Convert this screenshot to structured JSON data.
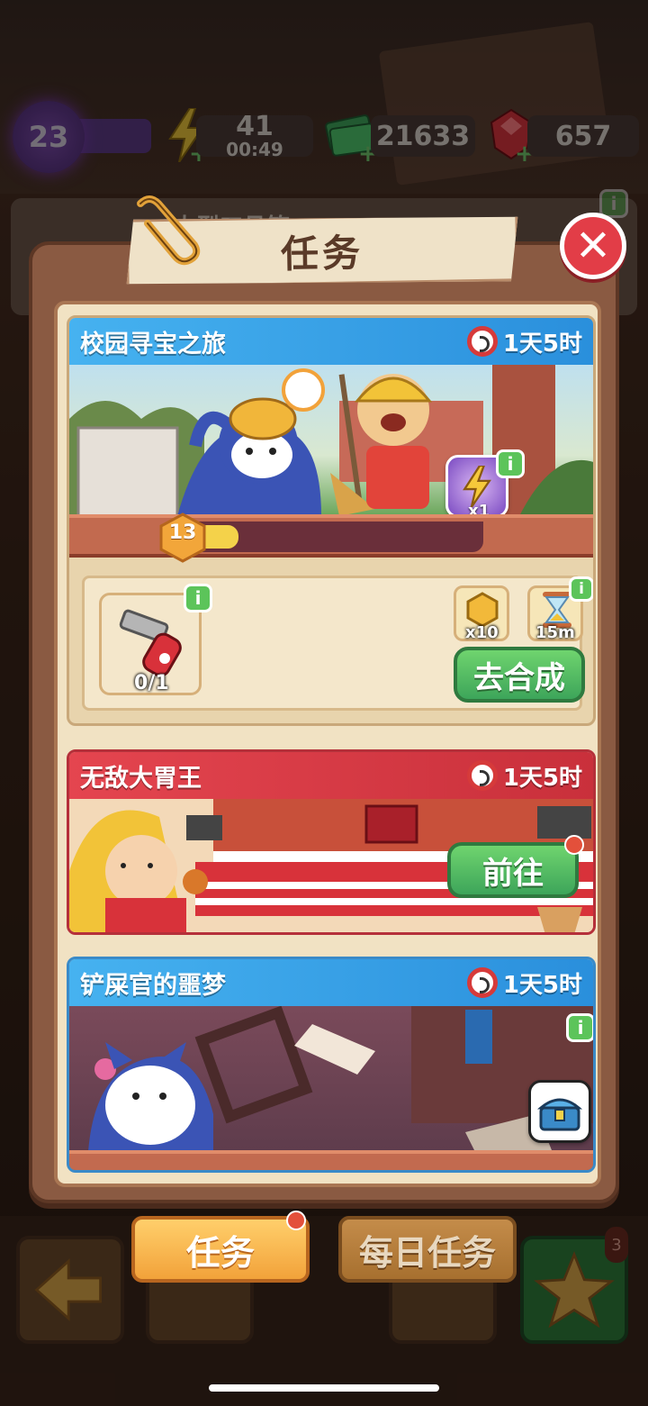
{
  "hud": {
    "level": "23",
    "energy": "41",
    "energy_timer": "00:49",
    "cash": "21633",
    "gems": "657"
  },
  "background": {
    "card_title": "大型工具箱"
  },
  "modal": {
    "title": "任务",
    "close_icon": "close-icon"
  },
  "quests": [
    {
      "title": "校园寻宝之旅",
      "timer": "1天5时",
      "header_color": "#46b2f0",
      "level_badge": "13",
      "level_progress": 0.2,
      "reward_multiplier": "x1",
      "requirement": {
        "item": "wrench-icon",
        "progress": "0/1"
      },
      "rewards": [
        {
          "icon": "coin-icon",
          "label": "x10"
        },
        {
          "icon": "hourglass-icon",
          "label": "15m"
        }
      ],
      "action_label": "去合成"
    },
    {
      "title": "无敌大胃王",
      "timer": "1天5时",
      "header_color": "#e4454f",
      "action_label": "前往"
    },
    {
      "title": "铲屎官的噩梦",
      "timer": "1天5时",
      "header_color": "#46b2f0",
      "reward_icon": "treasure-chest-icon"
    }
  ],
  "tabs": {
    "main": "任务",
    "daily": "每日任务"
  },
  "bottom": {
    "badge_count": "3"
  }
}
